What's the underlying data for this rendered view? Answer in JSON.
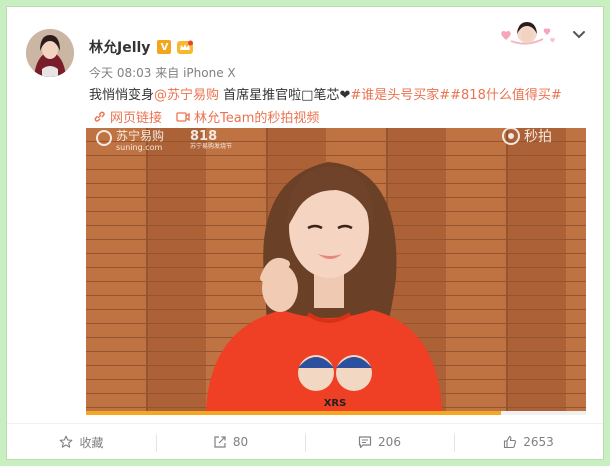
{
  "post": {
    "user_name": "林允Jelly",
    "verified_badge": "V",
    "time": "今天 08:03",
    "source_prefix": "来自",
    "source": "iPhone X",
    "text_part1": "我悄悄变身",
    "mention": "@苏宁易购",
    "text_part2": " 首席星推官啦□笔芯❤",
    "hashtag1": "#谁是头号买家#",
    "hashtag2": "#818什么值得买#",
    "link_web": "网页链接",
    "link_video": "林允Team的秒拍视频"
  },
  "video": {
    "watermark_brand": "苏宁易购",
    "watermark_domain": "suning.com",
    "watermark_logo": "818",
    "watermark_logo_sub": "苏宁易购发烧节",
    "app_watermark": "秒拍",
    "shirt_text": "XRS",
    "progress": 0.83
  },
  "actions": {
    "favorite_label": "收藏",
    "repost_count": "80",
    "comment_count": "206",
    "like_count": "2653"
  },
  "icons": [
    "link-icon",
    "video-icon",
    "star-icon",
    "repost-icon",
    "comment-icon",
    "like-icon",
    "chevron-down-icon",
    "crown-icon"
  ],
  "colors": {
    "accent": "#eb7350",
    "progress": "#f5a623",
    "background": "#c9eec0"
  }
}
